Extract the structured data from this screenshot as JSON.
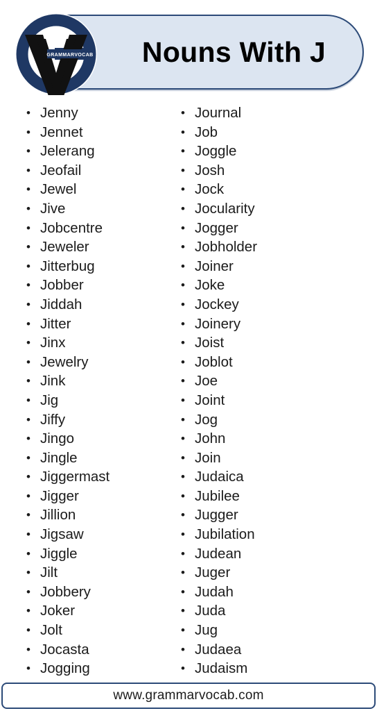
{
  "header": {
    "title": "Nouns With J",
    "logo": {
      "brand_text": "GRAMMARVOCAB",
      "mark_letters": "GV",
      "circle_color": "#1f3864",
      "v_color": "#111111",
      "disc_color": "#ffffff"
    },
    "pill_background": "#dce5f1",
    "pill_border": "#2c4a78"
  },
  "columns": [
    {
      "name": "left-column",
      "items": [
        "Jenny",
        "Jennet",
        "Jelerang",
        "Jeofail",
        "Jewel",
        "Jive",
        "Jobcentre",
        "Jeweler",
        "Jitterbug",
        "Jobber",
        "Jiddah",
        "Jitter",
        "Jinx",
        "Jewelry",
        "Jink",
        "Jig",
        "Jiffy",
        "Jingo",
        "Jingle",
        "Jiggermast",
        "Jigger",
        "Jillion",
        "Jigsaw",
        "Jiggle",
        "Jilt",
        "Jobbery",
        "Joker",
        "Jolt",
        "Jocasta",
        "Jogging"
      ]
    },
    {
      "name": "right-column",
      "items": [
        "Journal",
        "Job",
        "Joggle",
        "Josh",
        "Jock",
        "Jocularity",
        "Jogger",
        "Jobholder",
        "Joiner",
        "Joke",
        "Jockey",
        "Joinery",
        "Joist",
        "Joblot",
        "Joe",
        "Joint",
        "Jog",
        "John",
        "Join",
        "Judaica",
        "Jubilee",
        "Jugger",
        "Jubilation",
        "Judean",
        "Juger",
        "Judah",
        "Juda",
        "Jug",
        "Judaea",
        "Judaism"
      ]
    }
  ],
  "footer": {
    "website": "www.grammarvocab.com",
    "border_color": "#2c4a78"
  }
}
